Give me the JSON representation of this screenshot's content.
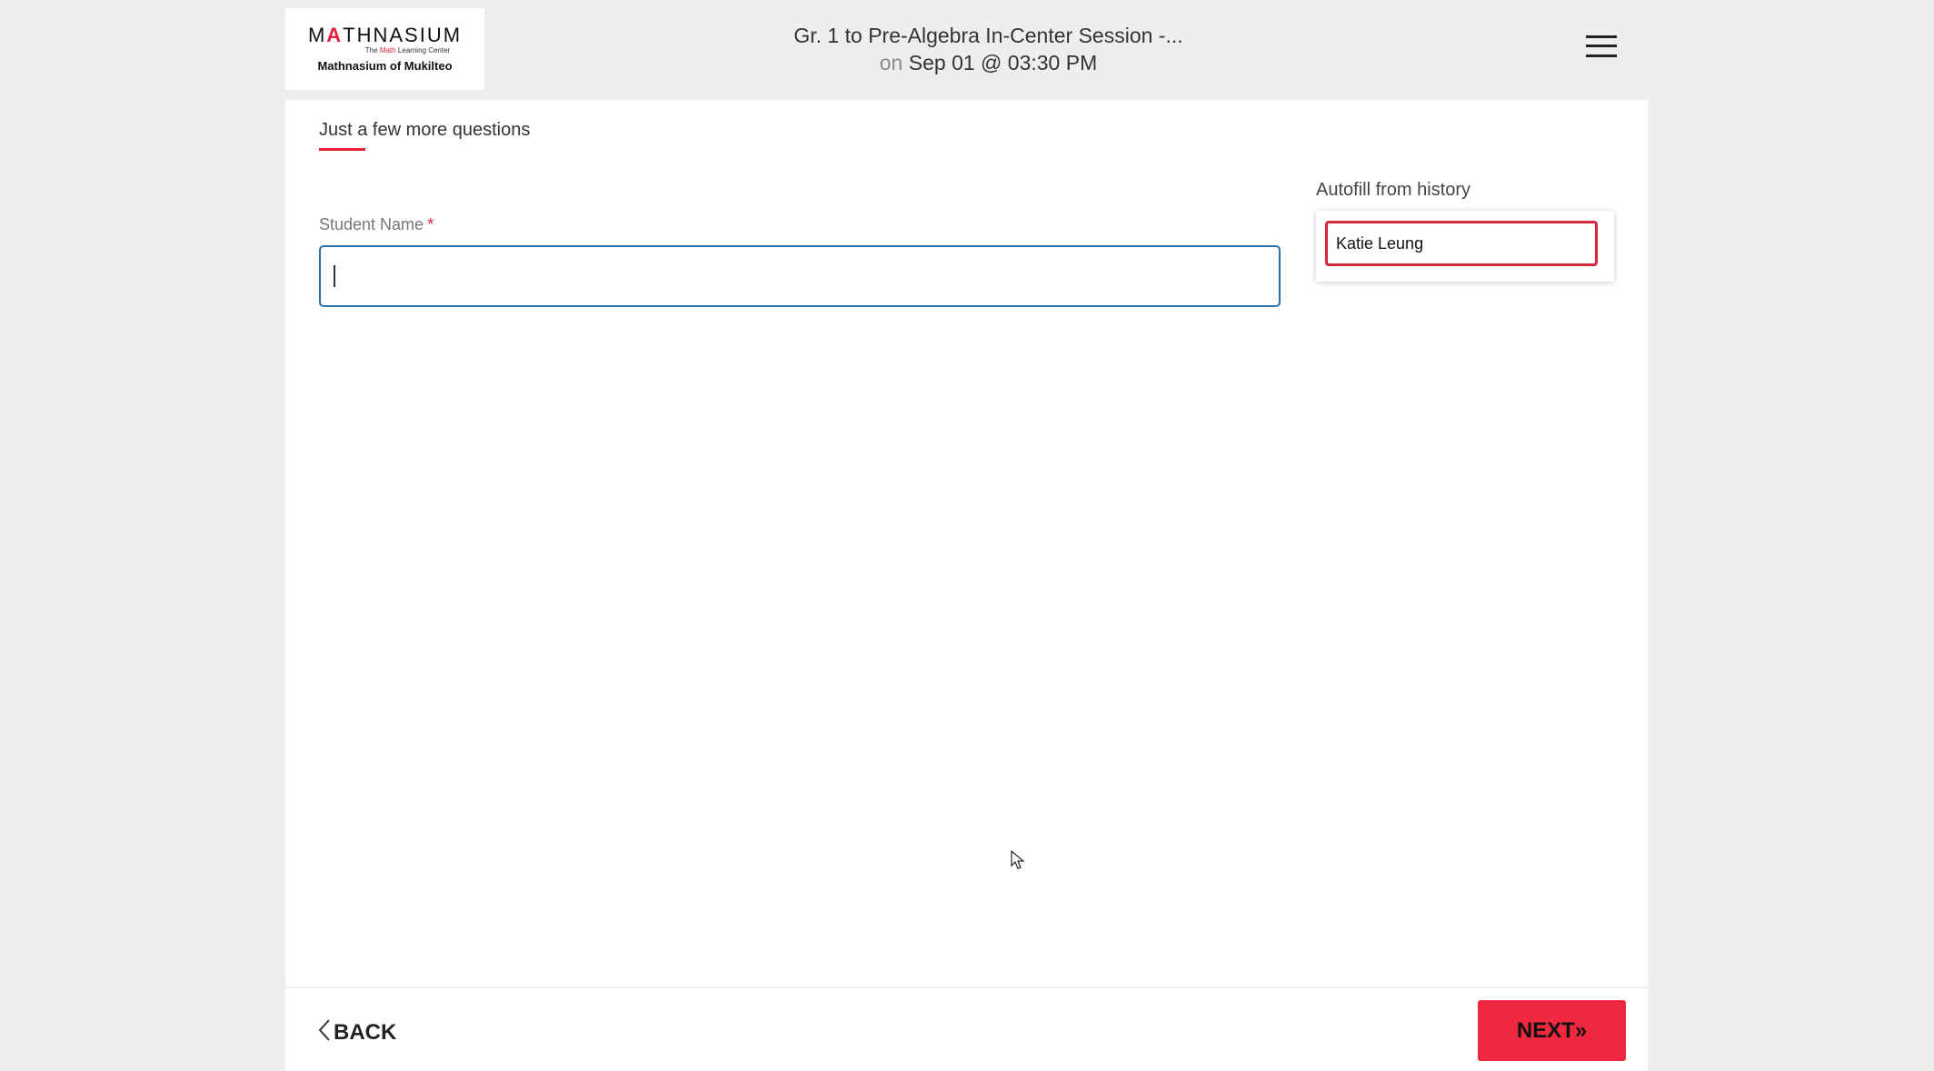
{
  "header": {
    "logo": {
      "wordmark_pre": "M",
      "wordmark_accent": "A",
      "wordmark_post": "THNASIUM",
      "tagline_pre": "The ",
      "tagline_accent": "Math",
      "tagline_post": " Learning Center",
      "center_name": "Mathnasium of Mukilteo"
    },
    "title": "Gr. 1 to Pre-Algebra In-Center Session -...",
    "subtitle_prefix": "on",
    "subtitle_date": "Sep 01 @ 03:30 PM",
    "menu_icon": "hamburger-menu-icon"
  },
  "form": {
    "section_title": "Just a few more questions",
    "student_name": {
      "label": "Student Name",
      "required_marker": "*",
      "value": "",
      "placeholder": ""
    }
  },
  "autofill": {
    "label": "Autofill from history",
    "items": [
      "Katie Leung"
    ]
  },
  "footer": {
    "back_label": "BACK",
    "back_icon": "chevron-left-icon",
    "next_label": "NEXT»"
  },
  "colors": {
    "accent": "#e8203a",
    "next_button": "#ef2840",
    "input_focus_border": "#2a6fb0",
    "page_background": "#eeeeee"
  }
}
